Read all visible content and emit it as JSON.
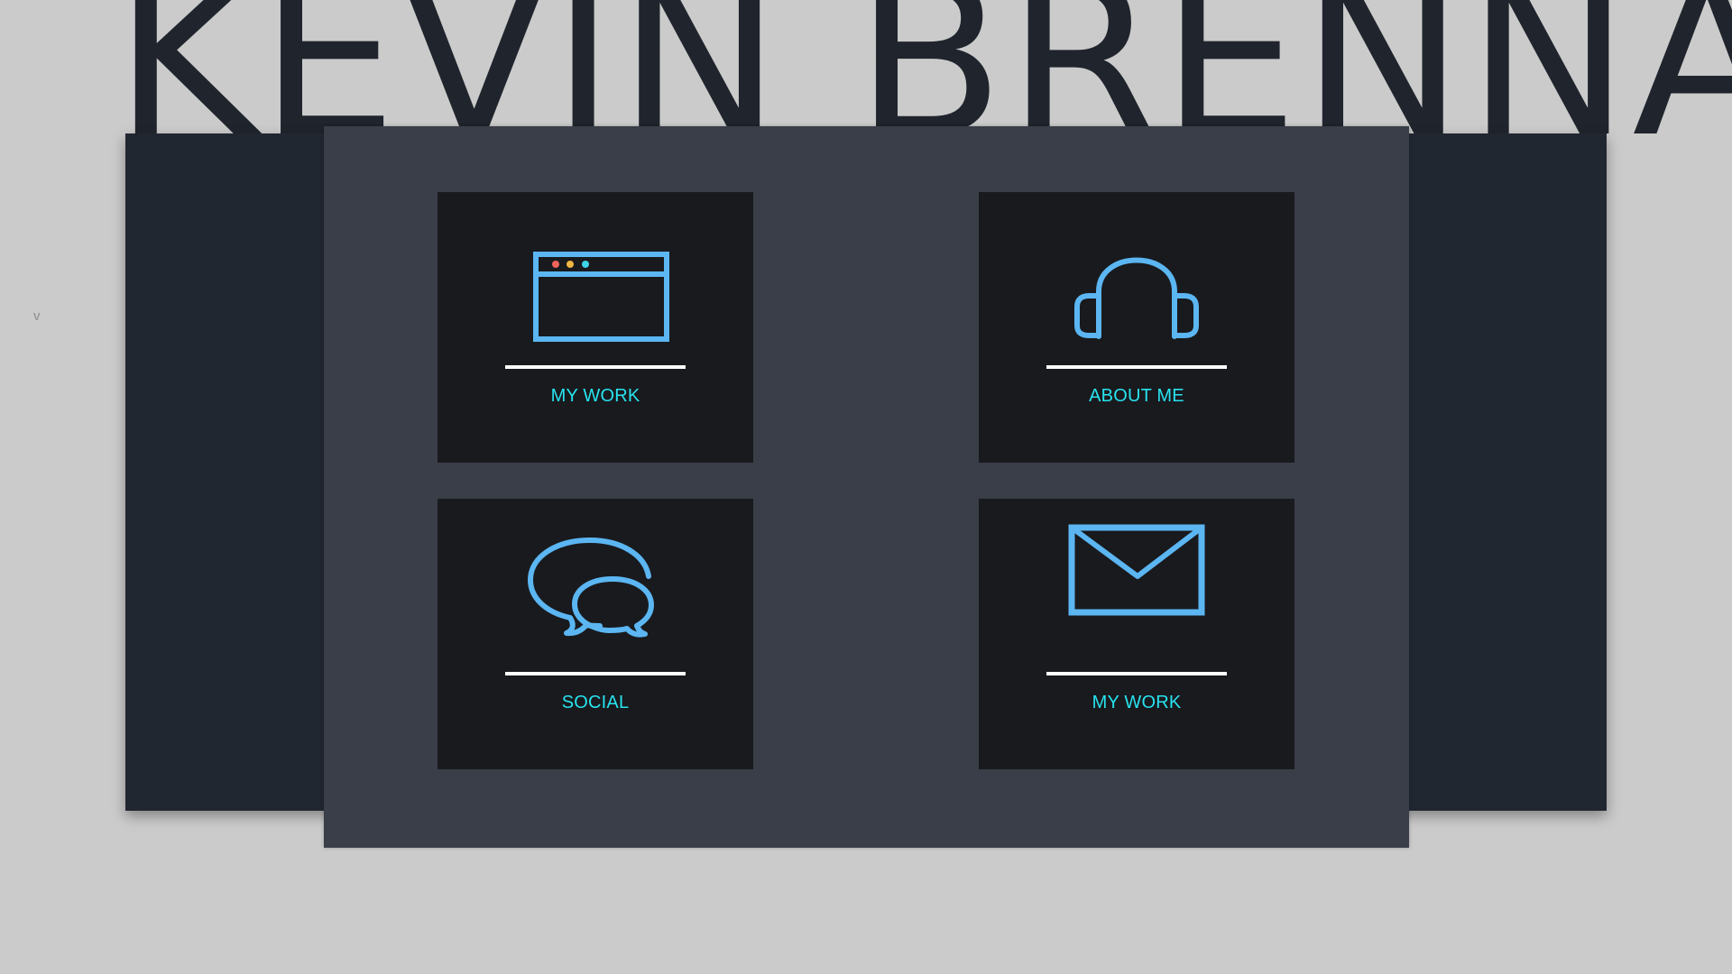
{
  "header": {
    "title": "KEVIN BRENNAN"
  },
  "side_toggle": {
    "label": "v"
  },
  "tiles": [
    {
      "label": "MY WORK",
      "icon": "browser-window-icon"
    },
    {
      "label": "ABOUT ME",
      "icon": "headphones-icon"
    },
    {
      "label": "SOCIAL",
      "icon": "chat-bubbles-icon"
    },
    {
      "label": "MY WORK",
      "icon": "envelope-icon"
    }
  ],
  "colors": {
    "page_background": "#cbcbcb",
    "title": "#20252d",
    "back_panel": "#212731",
    "front_panel": "#393e48",
    "tile_background": "#191a1e",
    "icon_stroke": "#5bb6f2",
    "label_text": "#27e3ef",
    "divider": "#ffffff",
    "window_dot_red": "#f0645a",
    "window_dot_yellow": "#f2b644",
    "window_dot_cyan": "#3ed3e8"
  }
}
